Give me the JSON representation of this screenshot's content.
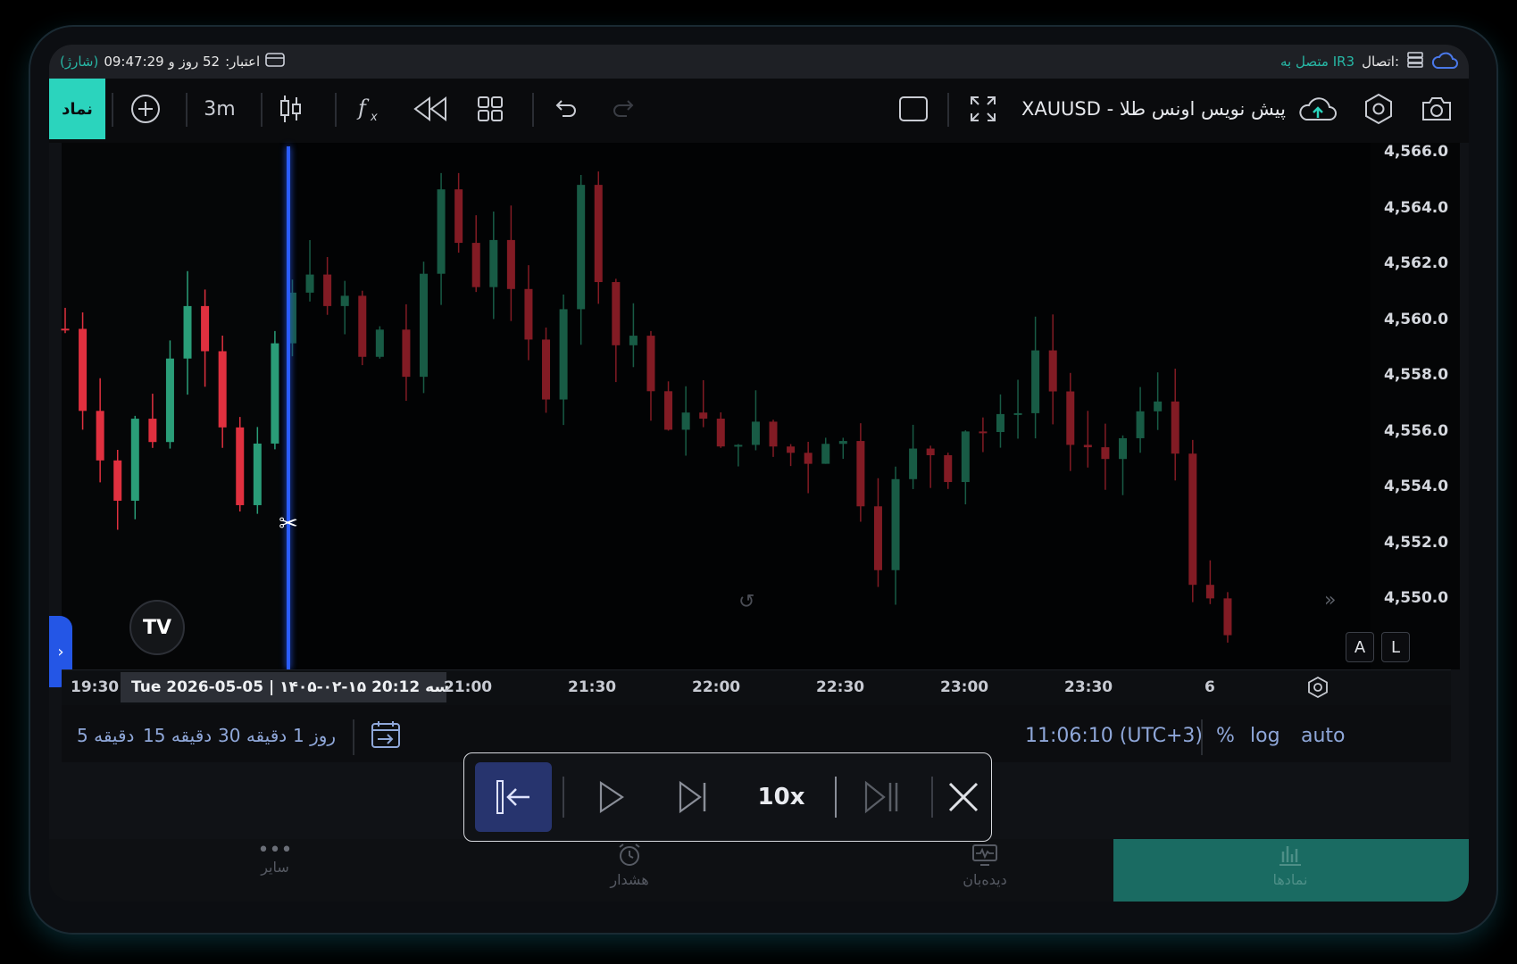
{
  "status": {
    "credit_label": "اعتبار:",
    "credit_value": "52 روز و 09:47:29",
    "credit_recharge": "(شارژ)",
    "connection_label": "اتصال:",
    "connection_value": "متصل به IR3"
  },
  "toolbar": {
    "symbol_button": "نماد",
    "timeframe": "3m",
    "chart_title": "XAUUSD - پیش نویس اونس طلا"
  },
  "chart": {
    "y_ticks": [
      "4,566.0",
      "4,564.0",
      "4,562.0",
      "4,560.0",
      "4,558.0",
      "4,556.0",
      "4,554.0",
      "4,552.0",
      "4,550.0"
    ],
    "x_ticks": [
      "19:30",
      "21:00",
      "21:30",
      "22:00",
      "22:30",
      "23:00",
      "23:30",
      "6"
    ],
    "crosshair_date_label": "Tue 2026-05-05 | ۱۴۰۵-۰۲-۱۵ 20:12   سه",
    "scale_a": "A",
    "scale_l": "L",
    "logo": "TV",
    "colors": {
      "up": "#2a9d78",
      "down": "#e0303f",
      "replay_line": "#2a5cff"
    }
  },
  "bottom": {
    "timeframes": [
      "5 دقیقه",
      "15 دقیقه",
      "30 دقیقه",
      "1 روز"
    ],
    "clock": "11:06:10 (UTC+3)",
    "percent": "%",
    "log": "log",
    "auto": "auto"
  },
  "replay": {
    "speed": "10x"
  },
  "nav": {
    "items": [
      "سایر",
      "هشدار",
      "دیده‌بان",
      "نمادها"
    ]
  }
}
